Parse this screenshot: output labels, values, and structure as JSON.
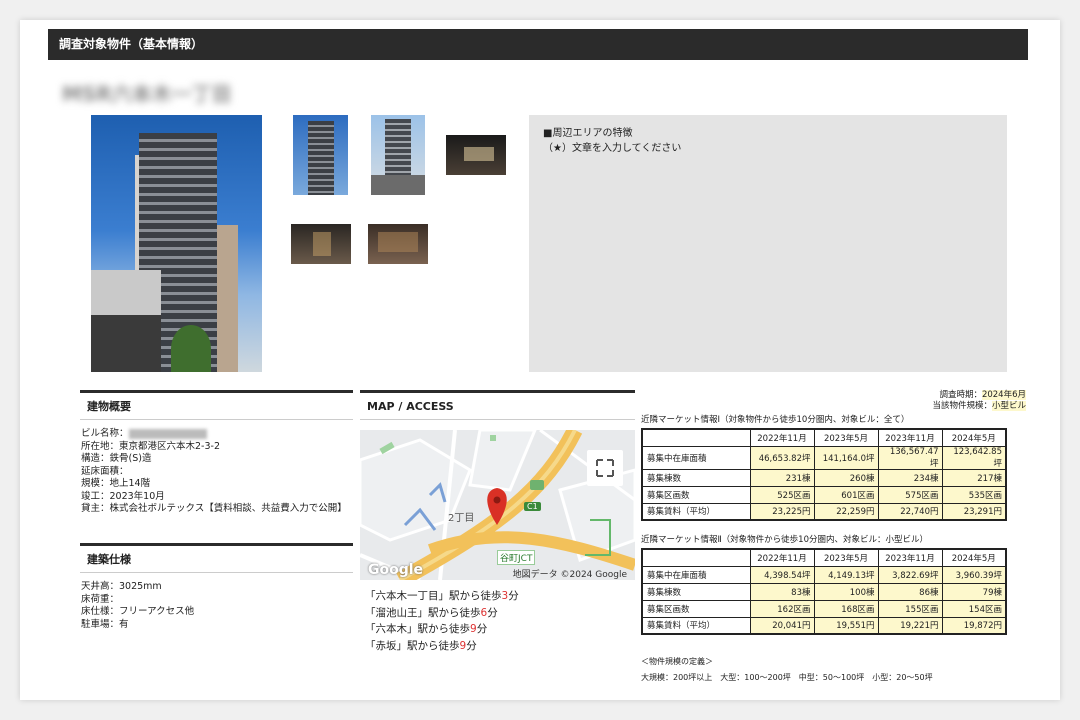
{
  "header": {
    "title": "調査対象物件（基本情報）"
  },
  "property_name_blurred": "MSR六本木一丁目",
  "area_box": {
    "line1": "■周辺エリアの特徴",
    "line2": "（★）文章を入力してください"
  },
  "building_overview": {
    "heading": "建物概要",
    "rows": [
      "ビル名称：",
      "所在地：東京都港区六本木2-3-2",
      "構造：鉄骨(S)造",
      "延床面積：",
      "規模：地上14階",
      "竣工：2023年10月",
      "貸主：株式会社ボルテックス【賃料相談、共益費入力で公開】"
    ]
  },
  "building_specs": {
    "heading": "建築仕様",
    "rows": [
      "天井高：3025mm",
      "床荷重：",
      "床仕様：フリーアクセス他",
      "駐車場：有"
    ]
  },
  "map": {
    "heading": "MAP / ACCESS",
    "district_label": "2丁目",
    "road_label": "C1",
    "jct_label": "谷町JCT",
    "google_logo": "Google",
    "attribution": "地図データ ©2024 Google"
  },
  "access": [
    {
      "pre": "「六本木一丁目」駅から徒歩",
      "num": "3",
      "post": "分"
    },
    {
      "pre": "「溜池山王」駅から徒歩",
      "num": "6",
      "post": "分"
    },
    {
      "pre": "「六本木」駅から徒歩",
      "num": "9",
      "post": "分"
    },
    {
      "pre": "「赤坂」駅から徒歩",
      "num": "9",
      "post": "分"
    }
  ],
  "survey": {
    "period_label": "調査時期：",
    "period_value": "2024年6月",
    "scale_label": "当該物件規模：",
    "scale_value": "小型ビル"
  },
  "market1": {
    "title": "近隣マーケット情報Ⅰ（対象物件から徒歩10分圏内、対象ビル：全て）",
    "columns": [
      "2022年11月",
      "2023年5月",
      "2023年11月",
      "2024年5月"
    ],
    "rows": [
      {
        "label": "募集中在庫面積",
        "values": [
          "46,653.82坪",
          "141,164.0坪",
          "136,567.47坪",
          "123,642.85坪"
        ]
      },
      {
        "label": "募集棟数",
        "values": [
          "231棟",
          "260棟",
          "234棟",
          "217棟"
        ]
      },
      {
        "label": "募集区画数",
        "values": [
          "525区画",
          "601区画",
          "575区画",
          "535区画"
        ]
      },
      {
        "label": "募集賃料（平均）",
        "values": [
          "23,225円",
          "22,259円",
          "22,740円",
          "23,291円"
        ]
      }
    ]
  },
  "market2": {
    "title": "近隣マーケット情報Ⅱ（対象物件から徒歩10分圏内、対象ビル：小型ビル）",
    "columns": [
      "2022年11月",
      "2023年5月",
      "2023年11月",
      "2024年5月"
    ],
    "rows": [
      {
        "label": "募集中在庫面積",
        "values": [
          "4,398.54坪",
          "4,149.13坪",
          "3,822.69坪",
          "3,960.39坪"
        ]
      },
      {
        "label": "募集棟数",
        "values": [
          "83棟",
          "100棟",
          "86棟",
          "79棟"
        ]
      },
      {
        "label": "募集区画数",
        "values": [
          "162区画",
          "168区画",
          "155区画",
          "154区画"
        ]
      },
      {
        "label": "募集賃料（平均）",
        "values": [
          "20,041円",
          "19,551円",
          "19,221円",
          "19,872円"
        ]
      }
    ]
  },
  "definitions": {
    "title": "＜物件規模の定義＞",
    "text": "大規模：200坪以上　大型：100〜200坪　中型：50〜100坪　小型：20〜50坪"
  },
  "icons": [
    "fullscreen-icon",
    "map-pin-icon"
  ],
  "colors": {
    "header_bg": "#2b2b2b",
    "highlight": "#fdf8cc",
    "walk_minutes": "#dd3333",
    "map_road": "#f2c15a",
    "pin": "#d93025"
  }
}
